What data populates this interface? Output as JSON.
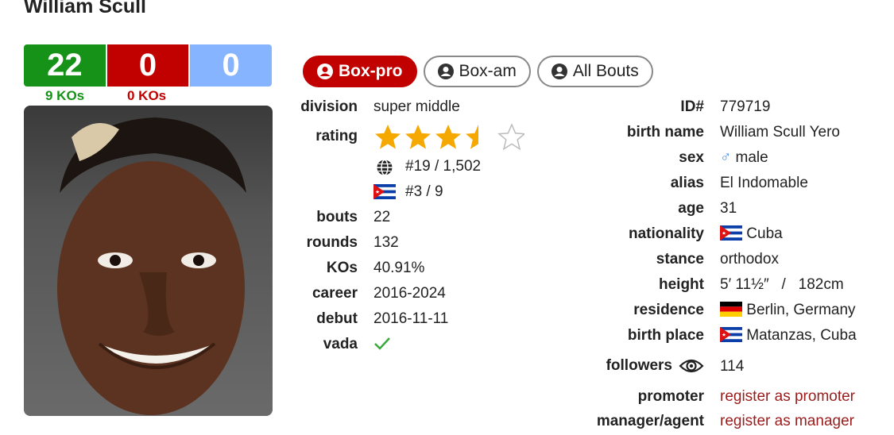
{
  "boxer": {
    "name": "William Scull"
  },
  "record": {
    "wins": "22",
    "losses": "0",
    "draws": "0",
    "win_kos": "9 KOs",
    "loss_kos": "0 KOs"
  },
  "tabs": [
    {
      "label": "Box-pro",
      "active": true
    },
    {
      "label": "Box-am",
      "active": false
    },
    {
      "label": "All Bouts",
      "active": false
    }
  ],
  "left_stats": {
    "division_label": "division",
    "division": "super middle",
    "rating_label": "rating",
    "rating_stars": 3.5,
    "rating_max": 5,
    "world_rank": "#19 / 1,502",
    "country_rank": "#3 / 9",
    "bouts_label": "bouts",
    "bouts": "22",
    "rounds_label": "rounds",
    "rounds": "132",
    "kos_label": "KOs",
    "kos": "40.91%",
    "career_label": "career",
    "career": "2016-2024",
    "debut_label": "debut",
    "debut": "2016-11-11",
    "vada_label": "vada",
    "vada_icon": "check-icon"
  },
  "right_stats": {
    "id_label": "ID#",
    "id": "779719",
    "birth_name_label": "birth name",
    "birth_name": "William Scull Yero",
    "sex_label": "sex",
    "sex": "male",
    "alias_label": "alias",
    "alias": "El Indomable",
    "age_label": "age",
    "age": "31",
    "nationality_label": "nationality",
    "nationality": "Cuba",
    "stance_label": "stance",
    "stance": "orthodox",
    "height_label": "height",
    "height": "5′ 11½″   /   182cm",
    "residence_label": "residence",
    "residence": "Berlin, Germany",
    "birth_place_label": "birth place",
    "birth_place": "Matanzas, Cuba",
    "followers_label": "followers",
    "followers": "114",
    "promoter_label": "promoter",
    "promoter": "register as promoter",
    "manager_label": "manager/agent",
    "manager": "register as manager"
  },
  "colors": {
    "win": "#179218",
    "loss": "#c10000",
    "draw": "#87b4ff",
    "star": "#f5a800",
    "link": "#9b1c1c"
  }
}
